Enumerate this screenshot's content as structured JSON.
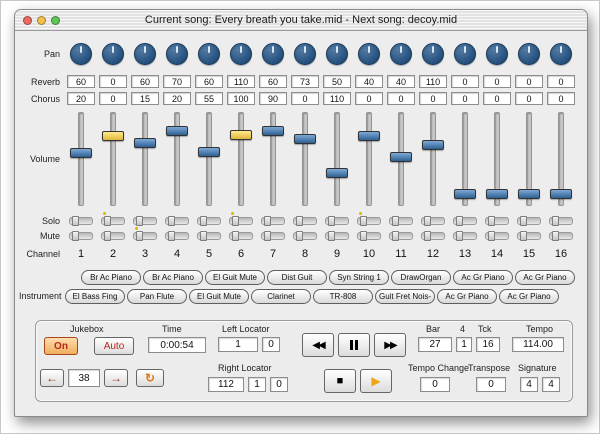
{
  "window": {
    "title": "Current song: Every breath you take.mid - Next song: decoy.mid"
  },
  "labels": {
    "pan": "Pan",
    "reverb": "Reverb",
    "chorus": "Chorus",
    "volume": "Volume",
    "solo": "Solo",
    "mute": "Mute",
    "channel": "Channel",
    "instrument": "Instrument"
  },
  "colors": {
    "knob_blue": "#24517f",
    "handle_blue": "#2e6094",
    "handle_yellow": "#eecb4a",
    "accent_red": "#b5271b",
    "accent_orange": "#e8881c"
  },
  "channels": [
    {
      "num": "1",
      "reverb": "60",
      "chorus": "20",
      "volume_pct": 42,
      "handle": "blue",
      "pan_deg": 0,
      "solo": false,
      "mute": false
    },
    {
      "num": "2",
      "reverb": "0",
      "chorus": "0",
      "volume_pct": 22,
      "handle": "yellow",
      "pan_deg": 0,
      "solo": true,
      "mute": false
    },
    {
      "num": "3",
      "reverb": "60",
      "chorus": "15",
      "volume_pct": 30,
      "handle": "blue",
      "pan_deg": 0,
      "solo": false,
      "mute": true
    },
    {
      "num": "4",
      "reverb": "70",
      "chorus": "20",
      "volume_pct": 16,
      "handle": "blue",
      "pan_deg": 0,
      "solo": false,
      "mute": false
    },
    {
      "num": "5",
      "reverb": "60",
      "chorus": "55",
      "volume_pct": 40,
      "handle": "blue",
      "pan_deg": 0,
      "solo": false,
      "mute": false
    },
    {
      "num": "6",
      "reverb": "110",
      "chorus": "100",
      "volume_pct": 20,
      "handle": "yellow",
      "pan_deg": 0,
      "solo": true,
      "mute": false
    },
    {
      "num": "7",
      "reverb": "60",
      "chorus": "90",
      "volume_pct": 16,
      "handle": "blue",
      "pan_deg": 0,
      "solo": false,
      "mute": false
    },
    {
      "num": "8",
      "reverb": "73",
      "chorus": "0",
      "volume_pct": 25,
      "handle": "blue",
      "pan_deg": 0,
      "solo": false,
      "mute": false
    },
    {
      "num": "9",
      "reverb": "50",
      "chorus": "110",
      "volume_pct": 66,
      "handle": "blue",
      "pan_deg": 0,
      "solo": false,
      "mute": false
    },
    {
      "num": "10",
      "reverb": "40",
      "chorus": "0",
      "volume_pct": 22,
      "handle": "blue",
      "pan_deg": 0,
      "solo": true,
      "mute": false
    },
    {
      "num": "11",
      "reverb": "40",
      "chorus": "0",
      "volume_pct": 47,
      "handle": "blue",
      "pan_deg": 0,
      "solo": false,
      "mute": false
    },
    {
      "num": "12",
      "reverb": "110",
      "chorus": "0",
      "volume_pct": 32,
      "handle": "blue",
      "pan_deg": 0,
      "solo": false,
      "mute": false
    },
    {
      "num": "13",
      "reverb": "0",
      "chorus": "0",
      "volume_pct": 90,
      "handle": "blue",
      "pan_deg": 0,
      "solo": false,
      "mute": false
    },
    {
      "num": "14",
      "reverb": "0",
      "chorus": "0",
      "volume_pct": 90,
      "handle": "blue",
      "pan_deg": 0,
      "solo": false,
      "mute": false
    },
    {
      "num": "15",
      "reverb": "0",
      "chorus": "0",
      "volume_pct": 90,
      "handle": "blue",
      "pan_deg": 0,
      "solo": false,
      "mute": false
    },
    {
      "num": "16",
      "reverb": "0",
      "chorus": "0",
      "volume_pct": 90,
      "handle": "blue",
      "pan_deg": 0,
      "solo": false,
      "mute": false
    }
  ],
  "instruments": {
    "row1": [
      "Br Ac Piano",
      "Br Ac Piano",
      "El Guit Mute",
      "Dist Guit",
      "Syn String 1",
      "DrawOrgan",
      "Ac Gr Piano",
      "Ac Gr Piano"
    ],
    "row2": [
      "El Bass Fing",
      "Pan Flute",
      "El Guit Mute",
      "Clarinet",
      "TR-808",
      "Guit Fret Nois-",
      "Ac Gr Piano",
      "Ac Gr Piano"
    ]
  },
  "transport": {
    "jukebox_label": "Jukebox",
    "on_label": "On",
    "auto_label": "Auto",
    "song_number": "38",
    "time_label": "Time",
    "time_value": "0:00:54",
    "left_locator_label": "Left Locator",
    "left_locator": [
      "1",
      "0"
    ],
    "right_locator_label": "Right Locator",
    "right_locator": [
      "112",
      "1",
      "0"
    ],
    "bar_label": "Bar",
    "beat_label": "4",
    "tick_label": "Tck",
    "bar_values": [
      "27",
      "1",
      "16"
    ],
    "tempo_label": "Tempo",
    "tempo_value": "114.00",
    "tempo_change_label": "Tempo Change",
    "transpose_label": "Transpose",
    "tempo_change_value": "0",
    "transpose_value": "0",
    "signature_label": "Signature",
    "signature_values": [
      "4",
      "4"
    ]
  }
}
